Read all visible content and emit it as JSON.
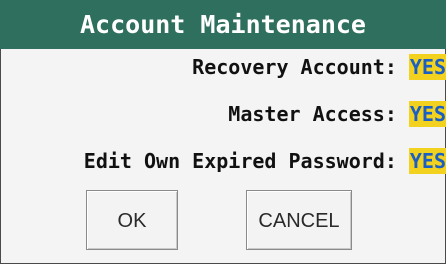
{
  "dialog": {
    "title": "Account Maintenance"
  },
  "settings": [
    {
      "label": "Recovery Account:",
      "value": "YES"
    },
    {
      "label": "Master Access:",
      "value": "YES"
    },
    {
      "label": "Edit Own Expired Password:",
      "value": "YES"
    }
  ],
  "buttons": {
    "ok_label": "OK",
    "cancel_label": "CANCEL"
  },
  "colors": {
    "title_bar": "#2f6f5d",
    "value_highlight": "#f2d21e",
    "value_text": "#1b5fc4"
  }
}
